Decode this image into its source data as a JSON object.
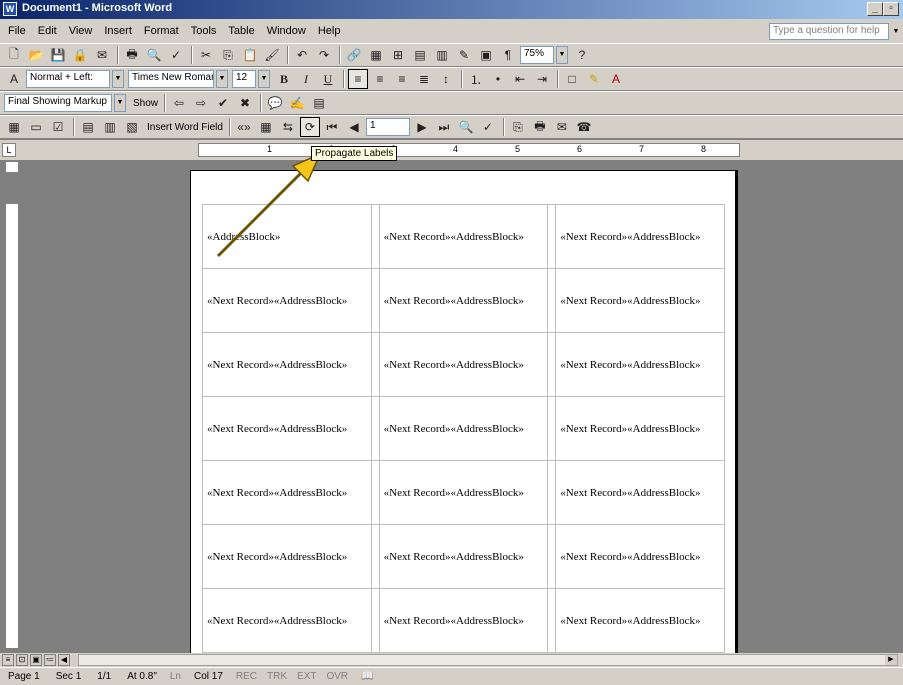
{
  "window": {
    "title": "Document1 - Microsoft Word",
    "app_icon": "W"
  },
  "window_buttons": [
    "_",
    "▫",
    "×"
  ],
  "menu": [
    "File",
    "Edit",
    "View",
    "Insert",
    "Format",
    "Tools",
    "Table",
    "Window",
    "Help"
  ],
  "ask_box": {
    "placeholder": "Type a question for help"
  },
  "standard_toolbar": {
    "zoom": "75%"
  },
  "formatting_toolbar": {
    "style": "Normal + Left:",
    "font": "Times New Roman",
    "size": "12",
    "bold": "B",
    "italic": "I",
    "underline": "U"
  },
  "reviewing_toolbar": {
    "display": "Final Showing Markup",
    "show": "Show"
  },
  "mail_merge_toolbar": {
    "insert_word_field": "Insert Word Field",
    "record": "1"
  },
  "tooltip": "Propagate Labels",
  "ruler_numbers": [
    "1",
    "2",
    "3",
    "4",
    "5",
    "6",
    "7",
    "8"
  ],
  "labels": {
    "first": "«AddressBlock»",
    "cell": "«Next Record»«AddressBlock»"
  },
  "status": {
    "page": "Page 1",
    "sec": "Sec 1",
    "pages": "1/1",
    "at": "At 0.8\"",
    "ln": "Ln",
    "col": "Col 17",
    "rec": "REC",
    "trk": "TRK",
    "ext": "EXT",
    "ovr": "OVR"
  },
  "colors": {
    "title_gradient_start": "#0a246a",
    "tooltip_bg": "#ffffe1",
    "arrow": "#f5c518"
  }
}
